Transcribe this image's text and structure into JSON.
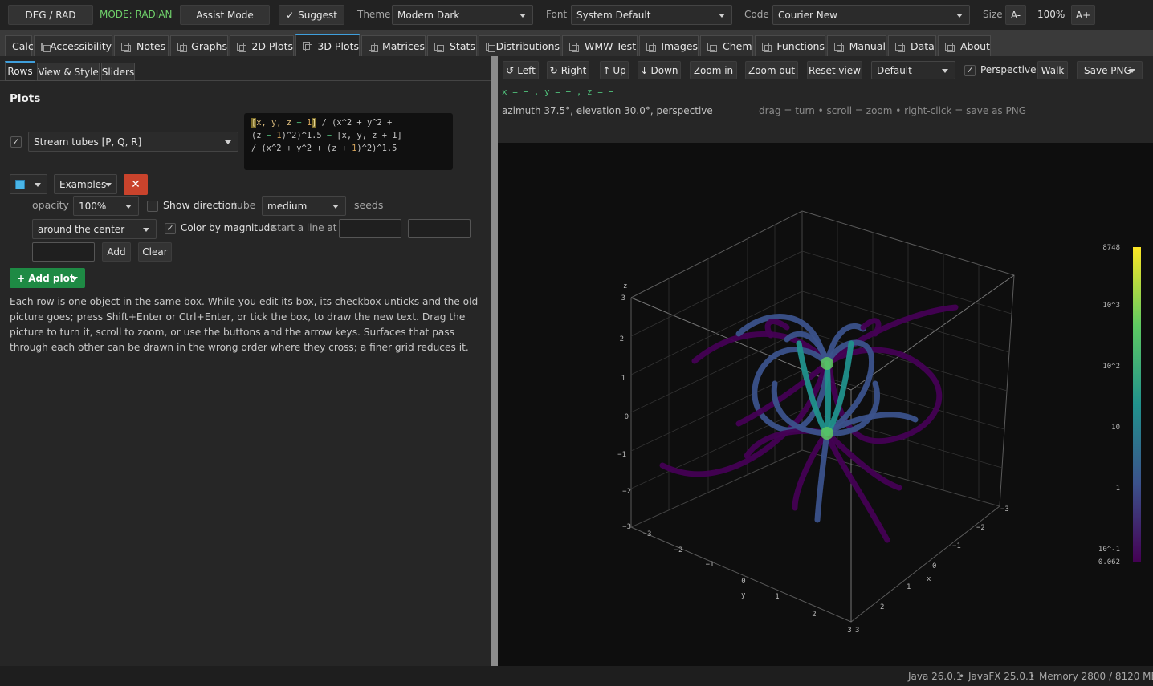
{
  "toolbar": {
    "deg_rad": "DEG / RAD",
    "mode": "MODE: RADIAN",
    "assist": "Assist Mode",
    "suggest": "Suggest",
    "theme_label": "Theme",
    "theme_value": "Modern Dark",
    "font_label": "Font",
    "font_value": "System Default",
    "code_label": "Code",
    "code_value": "Courier New",
    "size_label": "Size",
    "size_dec": "A-",
    "size_value": "100%",
    "size_inc": "A+"
  },
  "tabs": [
    "Calc",
    "Accessibility",
    "Notes",
    "Graphs",
    "2D Plots",
    "3D Plots",
    "Matrices",
    "Stats",
    "Distributions",
    "WMW Test",
    "Images",
    "Chem",
    "Functions",
    "Manual",
    "Data",
    "About"
  ],
  "active_tab": "3D Plots",
  "subtabs": [
    "Rows",
    "View & Style",
    "Sliders"
  ],
  "left": {
    "heading": "Plots",
    "plot_type": "Stream tubes [P, Q, R]",
    "formula_lines": [
      [
        "[",
        "x, y, z",
        " ",
        "−",
        " ",
        "1",
        "]",
        " / (x^2 + y^2 +"
      ],
      [
        "(z ",
        "−",
        " ",
        "1",
        ")^2)^1.5 ",
        "−",
        " [x, y, z + 1]"
      ],
      [
        "/ (x^2 + y^2 + (z + ",
        "1",
        ")^2)^1.5"
      ]
    ],
    "examples": "Examples",
    "opacity_label": "opacity",
    "opacity_value": "100%",
    "show_direction": "Show direction",
    "tube_label": "tube",
    "tube_value": "medium",
    "seeds_label": "seeds",
    "seed_value": "around the center",
    "color_by": "Color by magnitude",
    "start_line": "start a line at",
    "add": "Add",
    "clear": "Clear",
    "add_plot": "+ Add plot",
    "help": "Each row is one object in the same box. While you edit its box, its checkbox unticks and the old picture goes; press Shift+Enter or Ctrl+Enter, or tick the box, to draw the new text. Drag the picture to turn it, scroll to zoom, or use the buttons and the arrow keys. Surfaces that pass through each other can be drawn in the wrong order where they cross; a finer grid reduces it."
  },
  "view": {
    "left": "Left",
    "right": "Right",
    "up": "Up",
    "down": "Down",
    "zoom_in": "Zoom in",
    "zoom_out": "Zoom out",
    "reset": "Reset view",
    "preset": "Default",
    "perspective": "Perspective",
    "walk": "Walk",
    "save": "Save PNG",
    "coords": "x = − ,  y = − ,  z = −",
    "info": "azimuth 37.5°, elevation 30.0°, perspective",
    "hint": "drag = turn  •  scroll = zoom  •  right-click = save as PNG"
  },
  "colorbar": {
    "ticks": [
      "8748",
      "10^3",
      "10^2",
      "10",
      "1",
      "10^-1",
      "0.062"
    ],
    "colors": [
      "#fde725",
      "#5ec962",
      "#21918c",
      "#3b528b",
      "#440154"
    ]
  },
  "axes": {
    "z_label": "z",
    "x_label": "x",
    "y_label": "y",
    "z_ticks": [
      "3",
      "2",
      "1",
      "0",
      "−1",
      "−2",
      "−3"
    ],
    "x_ticks": [
      "−3",
      "−2",
      "−1",
      "0",
      "1",
      "2",
      "3"
    ],
    "y_ticks": [
      "−3",
      "−2",
      "−1",
      "0",
      "1",
      "2",
      "3"
    ]
  },
  "status": {
    "java": "Java 26.0.1",
    "javafx": "JavaFX 25.0.1",
    "memory": "Memory 2800 / 8120 MB"
  }
}
